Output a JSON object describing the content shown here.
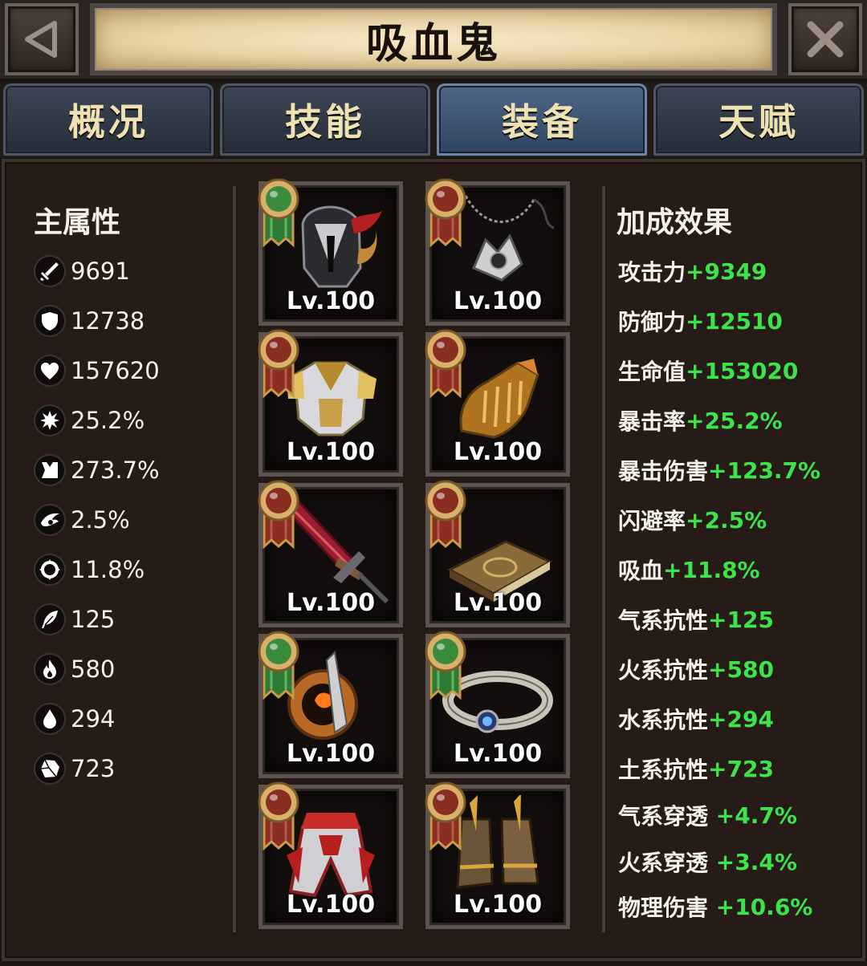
{
  "header": {
    "title": "吸血鬼",
    "back_icon": "back-arrow-icon",
    "close_icon": "close-x-icon"
  },
  "tabs": [
    {
      "label": "概况",
      "active": false
    },
    {
      "label": "技能",
      "active": false
    },
    {
      "label": "装备",
      "active": true
    },
    {
      "label": "天赋",
      "active": false
    }
  ],
  "stats": {
    "title": "主属性",
    "items": [
      {
        "icon": "sword-icon",
        "value": "9691"
      },
      {
        "icon": "shield-icon",
        "value": "12738"
      },
      {
        "icon": "heart-icon",
        "value": "157620"
      },
      {
        "icon": "burst-icon",
        "value": "25.2%"
      },
      {
        "icon": "crit-damage-icon",
        "value": "273.7%"
      },
      {
        "icon": "wing-dodge-icon",
        "value": "2.5%"
      },
      {
        "icon": "lifesteal-icon",
        "value": "11.8%"
      },
      {
        "icon": "feather-icon",
        "value": "125"
      },
      {
        "icon": "fire-icon",
        "value": "580"
      },
      {
        "icon": "water-drop-icon",
        "value": "294"
      },
      {
        "icon": "rock-icon",
        "value": "723"
      }
    ]
  },
  "equipment": {
    "colors": {
      "green": "#3c8a3c",
      "red": "#8a2e22",
      "gold": "#c99a4a"
    },
    "slots": [
      {
        "name": "helmet",
        "level": "Lv.100",
        "medal": "green"
      },
      {
        "name": "necklace",
        "level": "Lv.100",
        "medal": "red"
      },
      {
        "name": "armor",
        "level": "Lv.100",
        "medal": "red"
      },
      {
        "name": "gloves",
        "level": "Lv.100",
        "medal": "red"
      },
      {
        "name": "sword",
        "level": "Lv.100",
        "medal": "red"
      },
      {
        "name": "tome",
        "level": "Lv.100",
        "medal": "red"
      },
      {
        "name": "ring",
        "level": "Lv.100",
        "medal": "green"
      },
      {
        "name": "belt",
        "level": "Lv.100",
        "medal": "green"
      },
      {
        "name": "leg-armor",
        "level": "Lv.100",
        "medal": "red"
      },
      {
        "name": "boots",
        "level": "Lv.100",
        "medal": "red"
      }
    ]
  },
  "bonus": {
    "title": "加成效果",
    "items": [
      {
        "label": "攻击力",
        "value": "+9349"
      },
      {
        "label": "防御力",
        "value": "+12510"
      },
      {
        "label": "生命值",
        "value": "+153020"
      },
      {
        "label": "暴击率",
        "value": "+25.2%"
      },
      {
        "label": "暴击伤害",
        "value": "+123.7%"
      },
      {
        "label": "闪避率",
        "value": "+2.5%"
      },
      {
        "label": "吸血",
        "value": "+11.8%"
      },
      {
        "label": "气系抗性",
        "value": "+125"
      },
      {
        "label": "火系抗性",
        "value": "+580"
      },
      {
        "label": "水系抗性",
        "value": "+294"
      },
      {
        "label": "土系抗性",
        "value": "+723"
      },
      {
        "label": "气系穿透 ",
        "value": "+4.7%"
      },
      {
        "label": "火系穿透 ",
        "value": "+3.4%"
      },
      {
        "label": "物理伤害 ",
        "value": "+10.6%"
      }
    ]
  }
}
